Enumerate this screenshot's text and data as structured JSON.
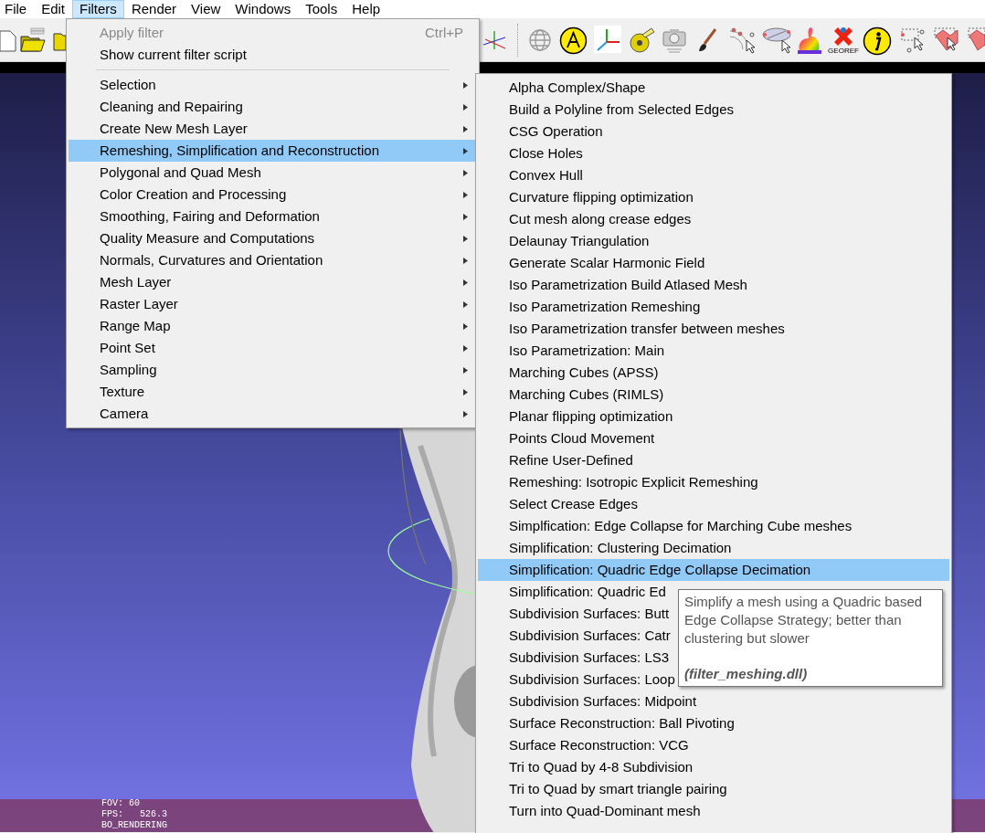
{
  "menubar": [
    {
      "label": "File",
      "selected": false
    },
    {
      "label": "Edit",
      "selected": false
    },
    {
      "label": "Filters",
      "selected": true
    },
    {
      "label": "Render",
      "selected": false
    },
    {
      "label": "View",
      "selected": false
    },
    {
      "label": "Windows",
      "selected": false
    },
    {
      "label": "Tools",
      "selected": false
    },
    {
      "label": "Help",
      "selected": false
    }
  ],
  "toolbar": {
    "georef_label": "GEOREF"
  },
  "viewport": {
    "overlay_lines": [
      "FOV: 60",
      "FPS:   526.3",
      "BO_RENDERING"
    ]
  },
  "filters_menu": {
    "actions": [
      {
        "label": "Apply filter",
        "shortcut": "Ctrl+P",
        "disabled": true
      },
      {
        "label": "Show current filter script",
        "disabled": false
      }
    ],
    "submenus": [
      {
        "label": "Selection",
        "selected": false
      },
      {
        "label": "Cleaning and Repairing",
        "selected": false
      },
      {
        "label": "Create New Mesh Layer",
        "selected": false
      },
      {
        "label": "Remeshing, Simplification and Reconstruction",
        "selected": true
      },
      {
        "label": "Polygonal and Quad Mesh",
        "selected": false
      },
      {
        "label": "Color Creation and Processing",
        "selected": false
      },
      {
        "label": "Smoothing, Fairing and Deformation",
        "selected": false
      },
      {
        "label": "Quality Measure and Computations",
        "selected": false
      },
      {
        "label": "Normals, Curvatures and Orientation",
        "selected": false
      },
      {
        "label": "Mesh Layer",
        "selected": false
      },
      {
        "label": "Raster Layer",
        "selected": false
      },
      {
        "label": "Range Map",
        "selected": false
      },
      {
        "label": "Point Set",
        "selected": false
      },
      {
        "label": "Sampling",
        "selected": false
      },
      {
        "label": "Texture",
        "selected": false
      },
      {
        "label": "Camera",
        "selected": false
      }
    ]
  },
  "remeshing_submenu": [
    {
      "label": "Alpha Complex/Shape",
      "selected": false
    },
    {
      "label": "Build a Polyline from Selected Edges",
      "selected": false
    },
    {
      "label": "CSG Operation",
      "selected": false
    },
    {
      "label": "Close Holes",
      "selected": false
    },
    {
      "label": "Convex Hull",
      "selected": false
    },
    {
      "label": "Curvature flipping optimization",
      "selected": false
    },
    {
      "label": "Cut mesh along crease edges",
      "selected": false
    },
    {
      "label": "Delaunay Triangulation",
      "selected": false
    },
    {
      "label": "Generate Scalar Harmonic Field",
      "selected": false
    },
    {
      "label": "Iso Parametrization Build Atlased Mesh",
      "selected": false
    },
    {
      "label": "Iso Parametrization Remeshing",
      "selected": false
    },
    {
      "label": "Iso Parametrization transfer between meshes",
      "selected": false
    },
    {
      "label": "Iso Parametrization: Main",
      "selected": false
    },
    {
      "label": "Marching Cubes (APSS)",
      "selected": false
    },
    {
      "label": "Marching Cubes (RIMLS)",
      "selected": false
    },
    {
      "label": "Planar flipping optimization",
      "selected": false
    },
    {
      "label": "Points Cloud Movement",
      "selected": false
    },
    {
      "label": "Refine User-Defined",
      "selected": false
    },
    {
      "label": "Remeshing: Isotropic Explicit Remeshing",
      "selected": false
    },
    {
      "label": "Select Crease Edges",
      "selected": false
    },
    {
      "label": "Simplfication: Edge Collapse for Marching Cube meshes",
      "selected": false
    },
    {
      "label": "Simplification: Clustering Decimation",
      "selected": false
    },
    {
      "label": "Simplification: Quadric Edge Collapse Decimation",
      "selected": true
    },
    {
      "label": "Simplification: Quadric Ed",
      "selected": false
    },
    {
      "label": "Subdivision Surfaces: Butt",
      "selected": false
    },
    {
      "label": "Subdivision Surfaces: Catr",
      "selected": false
    },
    {
      "label": "Subdivision Surfaces: LS3",
      "selected": false
    },
    {
      "label": "Subdivision Surfaces: Loop",
      "selected": false
    },
    {
      "label": "Subdivision Surfaces: Midpoint",
      "selected": false
    },
    {
      "label": "Surface Reconstruction: Ball Pivoting",
      "selected": false
    },
    {
      "label": "Surface Reconstruction: VCG",
      "selected": false
    },
    {
      "label": "Tri to Quad by 4-8 Subdivision",
      "selected": false
    },
    {
      "label": "Tri to Quad by smart triangle pairing",
      "selected": false
    },
    {
      "label": "Turn into Quad-Dominant mesh",
      "selected": false
    }
  ],
  "tooltip": {
    "description": "Simplify a mesh using a Quadric based Edge Collapse Strategy; better than clustering but slower",
    "source": "(filter_meshing.dll)"
  }
}
